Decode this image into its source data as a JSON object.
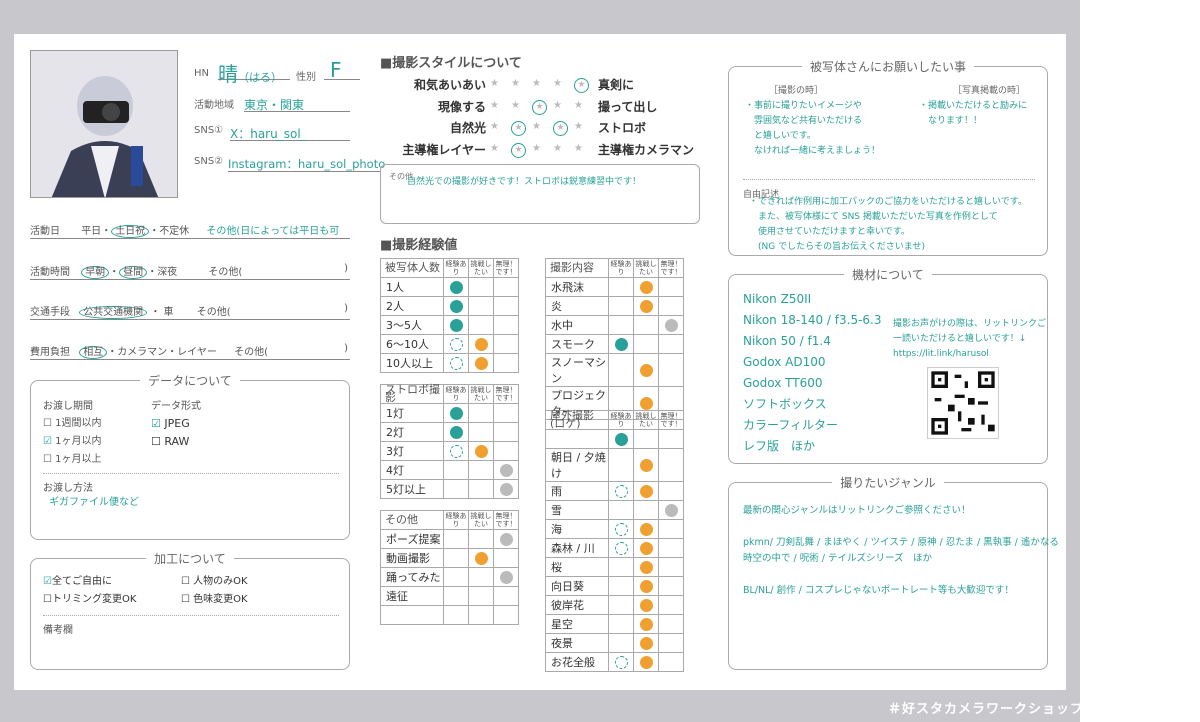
{
  "profile": {
    "hn_label": "HN",
    "hn_value": "晴",
    "hn_reading": "（はる）",
    "gender_label": "性別",
    "gender_value": "F",
    "area_label": "活動地域",
    "area_value": "東京・関東",
    "sns1_label": "SNS①",
    "sns1_value": "X：haru_sol_",
    "sns2_label": "SNS②",
    "sns2_value": "Instagram：haru_sol_photo"
  },
  "activity": {
    "day_label": "活動日",
    "day_opts": [
      "平日",
      "土日祝",
      "不定休"
    ],
    "day_other": "その他(日によっては平日も可",
    "time_label": "活動時間",
    "time_opts": [
      "早朝",
      "昼間",
      "深夜"
    ],
    "time_other": "その他(",
    "trans_label": "交通手段",
    "trans_opts": [
      "公共交通機関",
      "車"
    ],
    "trans_other": "その他(",
    "cost_label": "費用負担",
    "cost_opts": [
      "相互",
      "カメラマン・レイヤー"
    ],
    "cost_other": "その他(",
    "close_paren": ")"
  },
  "data_box": {
    "title": "データについて",
    "period_label": "お渡し期間",
    "period_opts": [
      "1週間以内",
      "1ヶ月以内",
      "1ヶ月以上"
    ],
    "format_label": "データ形式",
    "format_opts": [
      "JPEG",
      "RAW"
    ],
    "method_label": "お渡し方法",
    "method_value": "ギガファイル便など"
  },
  "edit_box": {
    "title": "加工について",
    "opts": [
      "全てご自由に",
      "人物のみOK",
      "トリミング変更OK",
      "色味変更OK"
    ],
    "memo_label": "備考欄"
  },
  "style": {
    "title": "■撮影スタイルについて",
    "rows": [
      {
        "left": "和気あいあい",
        "right": "真剣に",
        "pos": 4
      },
      {
        "left": "現像する",
        "right": "撮って出し",
        "pos": 2
      },
      {
        "left": "自然光",
        "right": "ストロボ",
        "pos": "1,3"
      },
      {
        "left": "主導権レイヤー",
        "right": "主導権カメラマン",
        "pos": 1
      }
    ],
    "other_label": "その他",
    "other_text": "自然光での撮影が好きです！ストロボは鋭意練習中です！"
  },
  "experience": {
    "title": "■撮影経験値",
    "col_heads": [
      "経験あり",
      "挑戦したい",
      "無理！です！"
    ],
    "t1": {
      "head": "被写体人数",
      "rows": [
        [
          "1人",
          "t",
          "",
          ""
        ],
        [
          "2人",
          "t",
          "",
          ""
        ],
        [
          "3〜5人",
          "t",
          "",
          ""
        ],
        [
          "6〜10人",
          "d",
          "o",
          ""
        ],
        [
          "10人以上",
          "d",
          "o",
          ""
        ]
      ]
    },
    "t2": {
      "head": "ストロボ撮影",
      "rows": [
        [
          "1灯",
          "t",
          "",
          ""
        ],
        [
          "2灯",
          "t",
          "",
          ""
        ],
        [
          "3灯",
          "d",
          "o",
          ""
        ],
        [
          "4灯",
          "",
          "",
          "g"
        ],
        [
          "5灯以上",
          "",
          "",
          "g"
        ]
      ]
    },
    "t3": {
      "head": "その他",
      "rows": [
        [
          "ポーズ提案",
          "",
          "",
          "g"
        ],
        [
          "動画撮影",
          "",
          "o",
          ""
        ],
        [
          "踊ってみた",
          "",
          "",
          "g"
        ],
        [
          "遠征",
          "",
          "",
          ""
        ],
        [
          "",
          "",
          "",
          ""
        ]
      ]
    },
    "t4": {
      "head": "撮影内容",
      "rows": [
        [
          "水飛沫",
          "",
          "o",
          ""
        ],
        [
          "炎",
          "",
          "o",
          ""
        ],
        [
          "水中",
          "",
          "",
          "g"
        ],
        [
          "スモーク",
          "t",
          "",
          ""
        ],
        [
          "スノーマシン",
          "",
          "o",
          ""
        ],
        [
          "プロジェクター",
          "",
          "o",
          ""
        ]
      ]
    },
    "t5": {
      "head": "屋外撮影(ロケ)",
      "rows": [
        [
          "",
          "t",
          "",
          ""
        ],
        [
          "朝日 / 夕焼け",
          "",
          "o",
          ""
        ],
        [
          "雨",
          "d",
          "o",
          ""
        ],
        [
          "雪",
          "",
          "",
          "g"
        ],
        [
          "海",
          "d",
          "o",
          ""
        ],
        [
          "森林 / 川",
          "d",
          "o",
          ""
        ],
        [
          "桜",
          "",
          "o",
          ""
        ],
        [
          "向日葵",
          "",
          "o",
          ""
        ],
        [
          "彼岸花",
          "",
          "o",
          ""
        ],
        [
          "星空",
          "",
          "o",
          ""
        ],
        [
          "夜景",
          "",
          "o",
          ""
        ],
        [
          "お花全般",
          "d",
          "o",
          ""
        ]
      ]
    }
  },
  "requests": {
    "title": "被写体さんにお願いしたい事",
    "left_head": "［撮影の時］",
    "left_text": [
      "・事前に撮りたいイメージや",
      "　雰囲気など共有いただける",
      "　と嬉しいです。",
      "　なければ一緒に考えましょう！"
    ],
    "right_head": "［写真掲載の時］",
    "right_text": [
      "・掲載いただけると励みに",
      "　なります！！"
    ],
    "free_label": "自由記述",
    "free_text": [
      "・できれば作例用に加工パックのご協力をいただけると嬉しいです。",
      "　また、被写体様にて SNS 掲載いただいた写真を作例として",
      "　使用させていただけますと幸いです。",
      "　(NG でしたらその旨お伝えくださいませ)"
    ]
  },
  "equipment": {
    "title": "機材について",
    "items": [
      "Nikon Z50II",
      "Nikon 18-140 / f3.5-6.3",
      "Nikon 50 / f1.4",
      "Godox AD100",
      "Godox TT600",
      "ソフトボックス",
      "カラーフィルター",
      "レフ版　ほか"
    ],
    "note": [
      "撮影お声がけの際は、リットリンクご",
      "一読いただけると嬉しいです！↓",
      "https://lit.link/harusol"
    ]
  },
  "genre": {
    "title": "撮りたいジャンル",
    "lines": [
      "最新の関心ジャンルはリットリンクご参照ください！",
      "",
      "pkmn/ 刀剣乱舞 / まほやく / ツイステ / 原神 / 忍たま / 黒執事 / 遙かなる",
      "時空の中で / 呪術 / テイルズシリーズ　ほか",
      "",
      "BL/NL/ 創作 / コスプレじゃないポートレート等も大歓迎です！"
    ]
  },
  "footer": "＃好スタカメラワークショップ",
  "colors": {
    "accent": "#2aa198",
    "orange": "#f0a030",
    "gray": "#bbbbbb",
    "frame": "#c8c8cc"
  }
}
